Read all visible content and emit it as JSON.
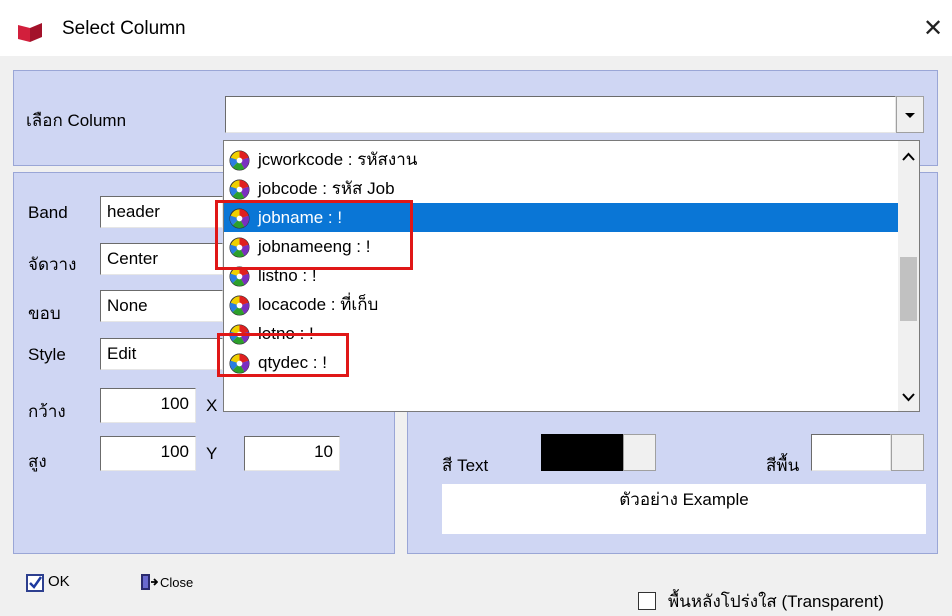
{
  "window": {
    "title": "Select Column",
    "close_glyph": "✕"
  },
  "column_select": {
    "label": "เลือก Column",
    "value": ""
  },
  "props": {
    "band_label": "Band",
    "band_value": "header",
    "align_label": "จัดวาง",
    "align_value": "Center",
    "border_label": "ขอบ",
    "border_value": "None",
    "style_label": "Style",
    "style_value": "Edit",
    "width_label": "กว้าง",
    "width_value": "100",
    "height_label": "สูง",
    "height_value": "100",
    "x_label": "X",
    "y_label": "Y",
    "y_value": "10"
  },
  "colors": {
    "text_color_label": "สี Text",
    "text_color": "#000000",
    "bg_color_label": "สีพื้น",
    "bg_color": "#ffffff",
    "selection": "#0a76d6",
    "highlight_box": "#e01717",
    "panel": "#cfd6f3"
  },
  "preview": {
    "text": "ตัวอย่าง Example"
  },
  "footer": {
    "ok_label": "OK",
    "close_label": "Close",
    "transparent_label": "พื้นหลังโปร่งใส (Transparent)",
    "transparent_checked": false
  },
  "dropdown": {
    "items": [
      {
        "label": "jcworkcode : รหัสงาน",
        "selected": false
      },
      {
        "label": "jobcode : รหัส Job",
        "selected": false
      },
      {
        "label": "jobname : !",
        "selected": true
      },
      {
        "label": "jobnameeng : !",
        "selected": false
      },
      {
        "label": "listno : !",
        "selected": false
      },
      {
        "label": "locacode : ที่เก็บ",
        "selected": false
      },
      {
        "label": "lotno : !",
        "selected": false
      },
      {
        "label": "qtydec : !",
        "selected": false
      }
    ],
    "scroll_position": 0.58
  },
  "icons": {
    "item_icon": "color-wheel-icon",
    "app_icon": "red-book-icon"
  }
}
